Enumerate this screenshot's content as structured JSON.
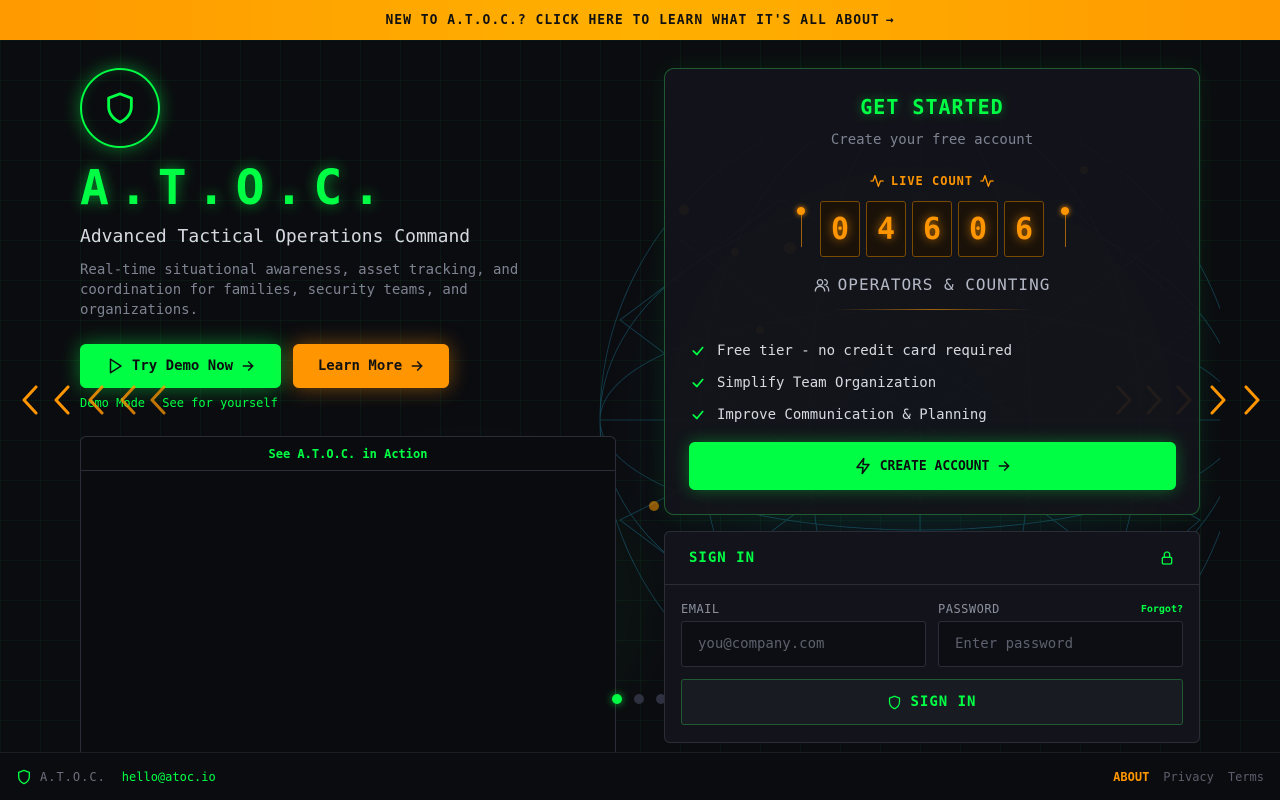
{
  "banner": {
    "text": "NEW TO A.T.O.C.? CLICK HERE TO LEARN WHAT IT'S ALL ABOUT",
    "arrow": "→"
  },
  "hero": {
    "brand": "A.T.O.C.",
    "tagline": "Advanced Tactical Operations Command",
    "description": "Real-time situational awareness, asset tracking, and coordination for families, security teams, and organizations.",
    "demo_button": "Try Demo Now",
    "learn_button": "Learn More",
    "demo_hint_mode": "Demo Mode",
    "demo_hint_see": "See for yourself",
    "video_title": "See A.T.O.C. in Action"
  },
  "carousel": {
    "slides": 3,
    "active": 0
  },
  "get_started": {
    "title": "GET STARTED",
    "subtitle": "Create your free account",
    "live_label": "LIVE COUNT",
    "digits": [
      "0",
      "4",
      "6",
      "0",
      "6"
    ],
    "operators_label": "OPERATORS & COUNTING",
    "features": [
      "Free tier - no credit card required",
      "Simplify Team Organization",
      "Improve Communication & Planning"
    ],
    "create_button": "CREATE ACCOUNT"
  },
  "signin": {
    "title": "SIGN IN",
    "email_label": "EMAIL",
    "email_placeholder": "you@company.com",
    "password_label": "PASSWORD",
    "password_placeholder": "Enter password",
    "forgot": "Forgot?",
    "button": "SIGN IN"
  },
  "footer": {
    "brand": "A.T.O.C.",
    "email": "hello@atoc.io",
    "links": [
      "ABOUT",
      "Privacy",
      "Terms"
    ]
  },
  "colors": {
    "accent_green": "#00ff44",
    "accent_orange": "#ff9500",
    "background": "#0b0c10"
  }
}
